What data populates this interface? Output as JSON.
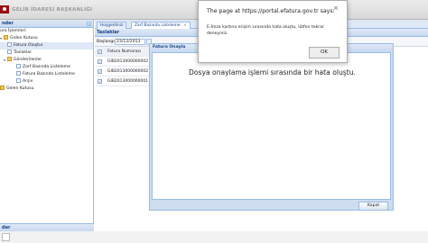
{
  "header": {
    "app_title": "GELİR İDARESİ BAŞKANLIĞI"
  },
  "sidebar": {
    "title": "nder",
    "collapse_label": "«",
    "items": [
      {
        "label": "ura İşlemleri",
        "level": 0
      },
      {
        "label": "Giden Kutusu",
        "level": 0
      },
      {
        "label": "Fatura Oluştur",
        "level": 1,
        "selected": true
      },
      {
        "label": "Taslaklar",
        "level": 1
      },
      {
        "label": "Gönderilenler",
        "level": 1
      },
      {
        "label": "Zarf Bazında Listeleme",
        "level": 2
      },
      {
        "label": "Fatura Bazında Listeleme",
        "level": 2
      },
      {
        "label": "Arşiv",
        "level": 2
      },
      {
        "label": "Gelen Kutusu",
        "level": 0
      }
    ],
    "footer": "dar"
  },
  "main": {
    "tabs": [
      {
        "label": "Hoşgeldiniz"
      },
      {
        "label": "Zarf Bazında Listeleme",
        "close": "×"
      }
    ],
    "grid_title": "Taslaklar",
    "date_label": "Başlangıç:",
    "date_value": "23/12/2013",
    "columns": [
      "Fatura Numarası"
    ],
    "rows": [
      "GIB2013000000002",
      "GIB2013000000002",
      "GIB2013000000001"
    ]
  },
  "modal": {
    "title": "Fatura Onayla",
    "message": "Dosya onaylama işlemi sırasında bir hata oluştu.",
    "close_button": "Kapat"
  },
  "alert": {
    "title": "The page at https://portal.efatura.gov.tr says:",
    "message": "E-İmza kartına erişim sırasında hata oluştu, lütfen tekrar deneyiniz.",
    "ok_button": "OK",
    "close": "×"
  },
  "colors": {
    "accent": "#15428b",
    "panel_border": "#99bbe8",
    "brand": "#9a0f12"
  }
}
